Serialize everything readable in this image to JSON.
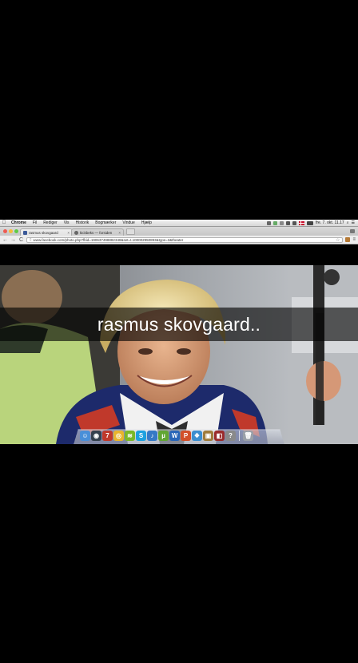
{
  "menubar": {
    "apple": "",
    "items": [
      "Chrome",
      "Fil",
      "Rediger",
      "Vis",
      "Historik",
      "Bogmærker",
      "Vindue",
      "Hjælp"
    ],
    "flag_color": "#c8102e",
    "clock": "fre. 7. okt.  11.17"
  },
  "tabs": [
    {
      "title": "rasmus skovgaard",
      "close": "×",
      "favicon": "facebook-icon"
    },
    {
      "title": "kickbeks — forsiden",
      "close": "×",
      "favicon": "tumblr-icon"
    }
  ],
  "toolbar": {
    "back": "←",
    "forward": "→",
    "reload": "C",
    "url": "www.facebook.com/photo.php?fbid=190637498882348&set=t.100002950893&type=3&theater",
    "star": "☆",
    "menu": "≡"
  },
  "caption": {
    "text": "rasmus skovgaard.."
  },
  "dock": {
    "icons": [
      {
        "name": "finder-icon",
        "color": "#4a8fd8",
        "glyph": "☺"
      },
      {
        "name": "dashboard-icon",
        "color": "#35414f",
        "glyph": "◉"
      },
      {
        "name": "calendar-icon",
        "color": "#c0392b",
        "glyph": "7"
      },
      {
        "name": "chrome-icon",
        "color": "#e8b42c",
        "glyph": "◎"
      },
      {
        "name": "spotify-icon",
        "color": "#7ab828",
        "glyph": "≋"
      },
      {
        "name": "skype-icon",
        "color": "#1da1e0",
        "glyph": "S"
      },
      {
        "name": "itunes-icon",
        "color": "#3579c6",
        "glyph": "♪"
      },
      {
        "name": "utorrent-icon",
        "color": "#61a632",
        "glyph": "µ"
      },
      {
        "name": "word-icon",
        "color": "#2a66b8",
        "glyph": "W"
      },
      {
        "name": "powerpoint-icon",
        "color": "#d2502a",
        "glyph": "P"
      },
      {
        "name": "dropbox-icon",
        "color": "#3b8ed0",
        "glyph": "❖"
      },
      {
        "name": "preview-icon",
        "color": "#a07c3c",
        "glyph": "▣"
      },
      {
        "name": "photo-booth-icon",
        "color": "#9b2c2c",
        "glyph": "◧"
      },
      {
        "name": "help-icon",
        "color": "#8a8a8a",
        "glyph": "?"
      },
      {
        "name": "trash-icon",
        "color": "#9aa0a8",
        "glyph": "🗑"
      }
    ]
  }
}
